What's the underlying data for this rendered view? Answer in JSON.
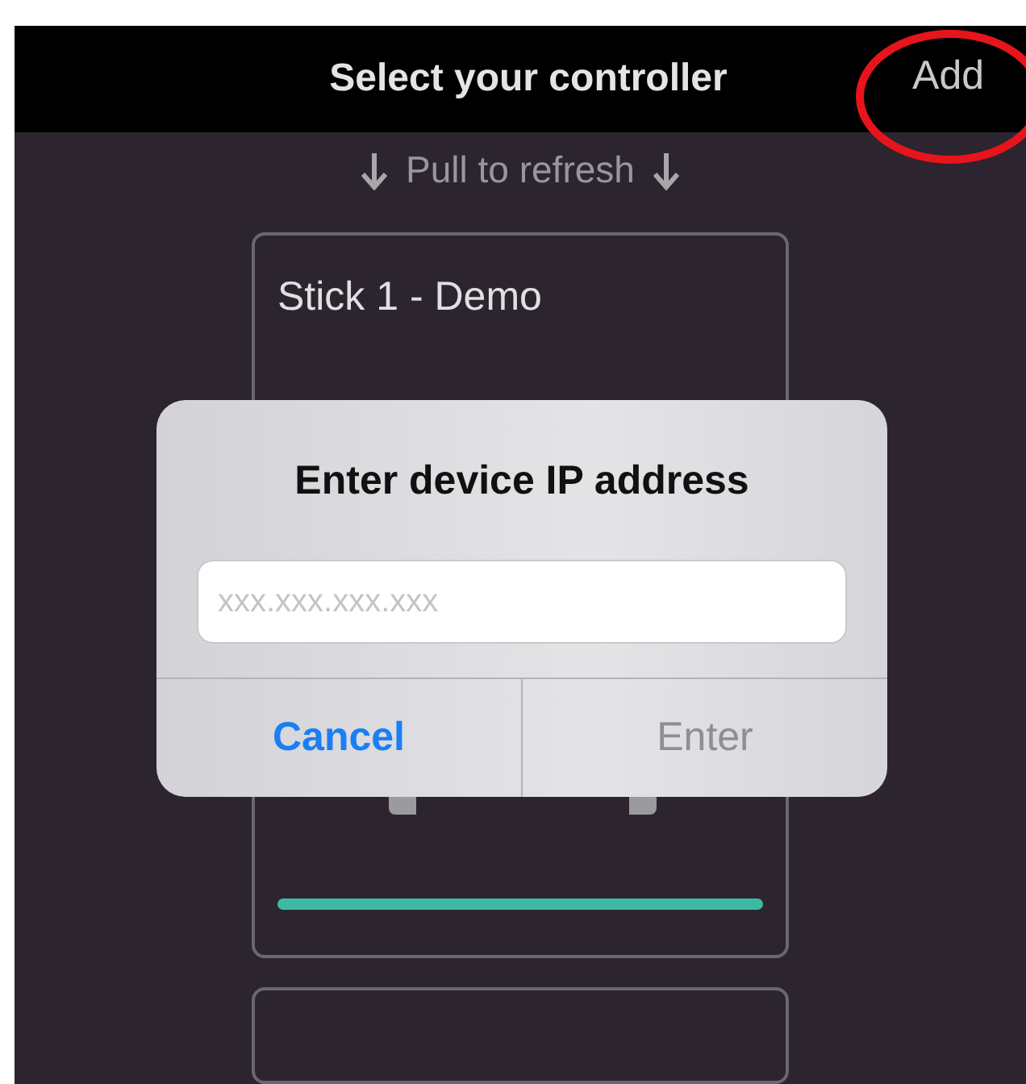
{
  "nav_bar": {
    "title": "Select your controller",
    "action": "Add"
  },
  "pull_hint": {
    "label": "Pull to refresh"
  },
  "devices": [
    {
      "name": "Stick 1 - Demo"
    }
  ],
  "dialog": {
    "title": "Enter device IP address",
    "placeholder": "xxx.xxx.xxx.xxx",
    "buttons": [
      {
        "label": "Cancel",
        "kind": "cancel",
        "disabled": false
      },
      {
        "label": "Enter",
        "kind": "confirm",
        "disabled": true
      }
    ]
  }
}
